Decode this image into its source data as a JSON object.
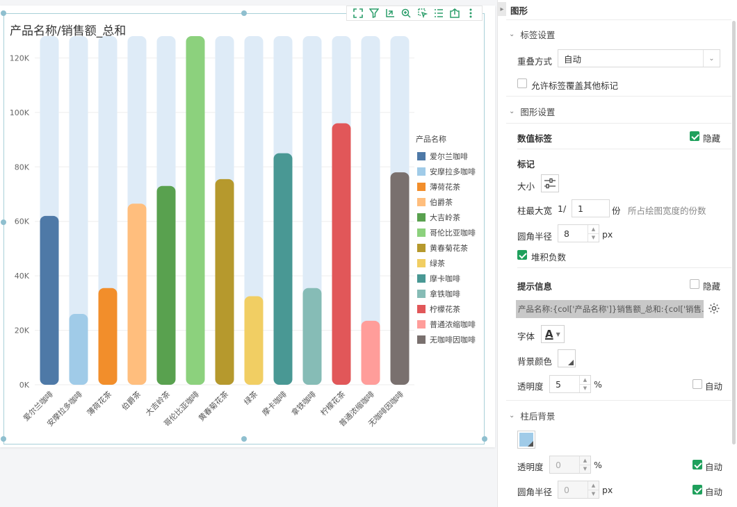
{
  "chart_data": {
    "type": "bar",
    "title": "产品名称/销售额_总和",
    "legend_title": "产品名称",
    "legend_position": "right",
    "categories": [
      "爱尔兰咖啡",
      "安摩拉多咖啡",
      "薄荷花茶",
      "伯爵茶",
      "大吉岭茶",
      "哥伦比亚咖啡",
      "黄春菊花茶",
      "绿茶",
      "摩卡咖啡",
      "拿铁咖啡",
      "柠檬花茶",
      "普通浓缩咖啡",
      "无咖啡因咖啡"
    ],
    "values": [
      62000,
      26000,
      35500,
      66500,
      73000,
      128000,
      75500,
      32500,
      85000,
      35500,
      96000,
      23500,
      78000
    ],
    "colors": [
      "#4e79a7",
      "#a0cbe8",
      "#f28e2b",
      "#ffbe7d",
      "#59a14f",
      "#8cd17d",
      "#b6992d",
      "#f1ce63",
      "#499894",
      "#86bcb6",
      "#e15759",
      "#ff9d9a",
      "#79706e"
    ],
    "background_bar_color": "#deebf7",
    "ylim": [
      0,
      128000
    ],
    "yticks": [
      0,
      20000,
      40000,
      60000,
      80000,
      100000,
      120000
    ],
    "ytick_labels": [
      "0K",
      "20K",
      "40K",
      "60K",
      "80K",
      "100K",
      "120K"
    ],
    "grid": true
  },
  "panel": {
    "title": "图形",
    "label_section": {
      "title": "标签设置",
      "overlap_label": "重叠方式",
      "overlap_value": "自动",
      "allow_cover_label": "允许标签覆盖其他标记",
      "allow_cover_checked": false
    },
    "shape_section": {
      "title": "图形设置",
      "value_label": "数值标签",
      "hide_label": "隐藏",
      "value_label_hidden": true,
      "mark_label": "标记",
      "size_label": "大小",
      "max_width_label": "柱最大宽",
      "max_width_prefix": "1/",
      "max_width_value": "1",
      "max_width_unit": "份",
      "max_width_hint": "所占绘图宽度的份数",
      "radius_label": "圆角半径",
      "radius_value": "8",
      "px_unit": "px",
      "stack_negative_label": "堆积负数",
      "stack_negative_checked": true,
      "tooltip_label": "提示信息",
      "tooltip_hidden": false,
      "tooltip_template": "产品名称:{col['产品名称']}销售额_总和:{col['销售...",
      "font_label": "字体",
      "font_glyph": "A",
      "bg_color_label": "背景颜色",
      "opacity_label": "透明度",
      "opacity_value": "5",
      "percent_unit": "%",
      "auto_label": "自动",
      "opacity_auto": false
    },
    "bar_bg_section": {
      "title": "柱后背景",
      "swatch_color": "#a0cbe8",
      "opacity_label": "透明度",
      "opacity_value": "0",
      "percent_unit": "%",
      "auto_label": "自动",
      "opacity_auto": true,
      "radius_label": "圆角半径",
      "radius_value": "0",
      "px_unit": "px",
      "radius_auto": true
    }
  }
}
